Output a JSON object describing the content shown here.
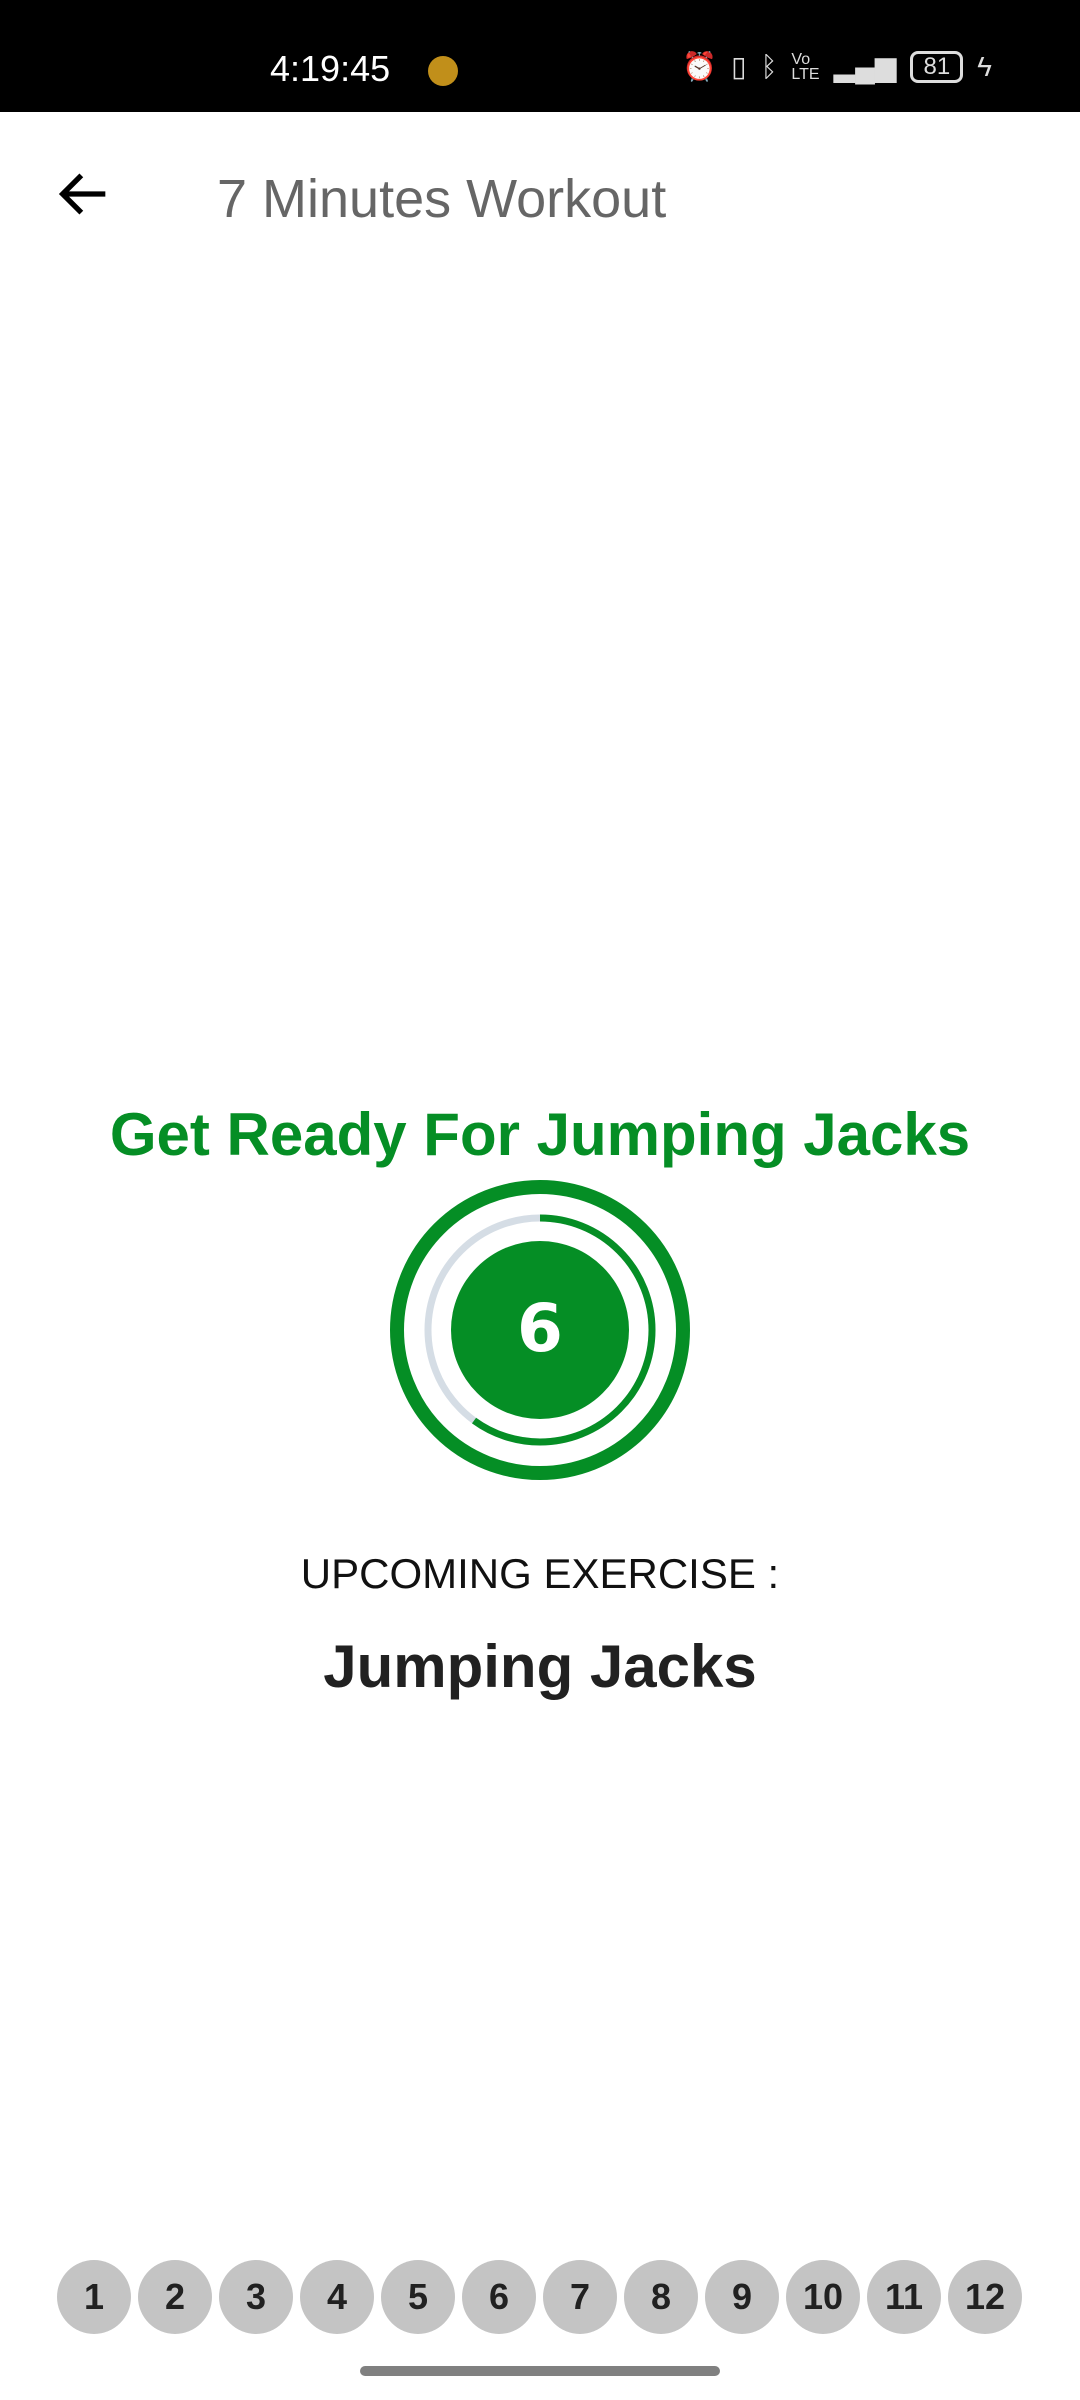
{
  "status_bar": {
    "time": "4:19:45",
    "battery": "81",
    "icons": [
      "download-notification-icon",
      "alarm-icon",
      "vibrate-icon",
      "bluetooth-icon",
      "volte-icon",
      "signal-icon",
      "battery-icon",
      "charging-icon"
    ]
  },
  "app_bar": {
    "title": "7 Minutes Workout",
    "back_icon": "arrow-left-icon"
  },
  "main": {
    "heading": "Get Ready For Jumping Jacks",
    "timer_value": "6",
    "timer_progress": 0.6,
    "upcoming_label": "UPCOMING EXERCISE :",
    "upcoming_name": "Jumping Jacks"
  },
  "steps": [
    "1",
    "2",
    "3",
    "4",
    "5",
    "6",
    "7",
    "8",
    "9",
    "10",
    "11",
    "12"
  ],
  "colors": {
    "accent": "#058e25",
    "track": "#d5dde5",
    "step_bg": "#c4c4c4"
  }
}
